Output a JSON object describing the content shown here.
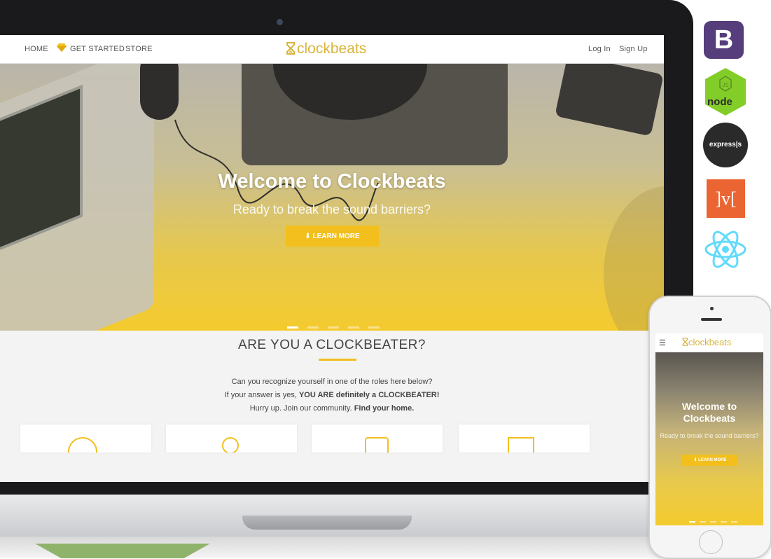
{
  "nav": {
    "home": "HOME",
    "get_started": "GET STARTED",
    "store": "STORE",
    "logo_text": "clockbeats",
    "login": "Log In",
    "signup": "Sign Up"
  },
  "hero": {
    "title": "Welcome to Clockbeats",
    "subtitle": "Ready to break the sound barriers?",
    "button": "LEARN MORE",
    "slide_count": 5,
    "active_slide": 1
  },
  "section": {
    "title": "ARE YOU A CLOCKBEATER?",
    "line1": "Can you recognize yourself in one of the roles here below?",
    "line2_prefix": "If your answer is yes, ",
    "line2_bold": "YOU ARE definitely a CLOCKBEATER!",
    "line3_prefix": "Hurry up. Join our community. ",
    "line3_bold": "Find your home."
  },
  "tech": {
    "bootstrap": "B",
    "node": "node",
    "express": "express|s",
    "mithril": "]v["
  },
  "phone": {
    "logo_text": "clockbeats",
    "title": "Welcome to Clockbeats",
    "subtitle": "Ready to break the sound barriers?",
    "button": "LEARN MORE"
  },
  "colors": {
    "accent": "#f2bf1d",
    "logo": "#d9b43a",
    "bootstrap": "#563d7c",
    "mithril": "#ea6532",
    "react": "#61dafb",
    "node": "#83cd29"
  }
}
